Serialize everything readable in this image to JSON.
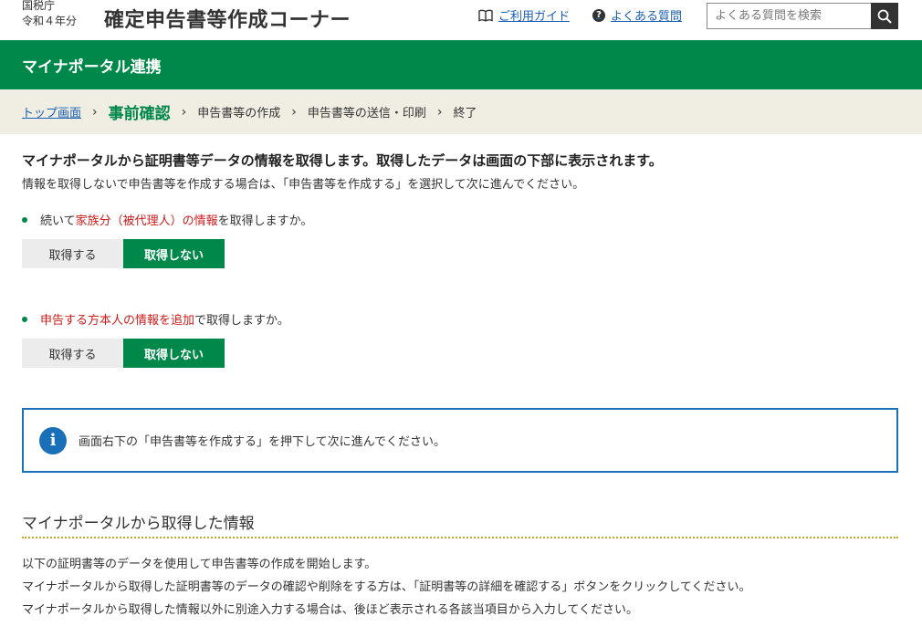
{
  "header": {
    "org_line1": "国税庁",
    "org_line2": "令和４年分",
    "title": "確定申告書等作成コーナー",
    "guide_link": "ご利用ガイド",
    "faq_link": "よくある質問",
    "search_placeholder": "よくある質問を検索"
  },
  "band": {
    "title": "マイナポータル連携"
  },
  "steps": [
    "トップ画面",
    "事前確認",
    "申告書等の作成",
    "申告書等の送信・印刷",
    "終了"
  ],
  "intro": {
    "lead": "マイナポータルから証明書等データの情報を取得します。取得したデータは画面の下部に表示されます。",
    "sub": "情報を取得しないで申告書等を作成する場合は、「申告書等を作成する」を選択して次に進んでください。"
  },
  "q1": {
    "prefix": "続いて",
    "highlight": "家族分（被代理人）の情報",
    "suffix": "を取得しますか。",
    "yes": "取得する",
    "no": "取得しない"
  },
  "q2": {
    "highlight": "申告する方本人の情報を追加",
    "suffix": "で取得しますか。",
    "yes": "取得する",
    "no": "取得しない"
  },
  "info": {
    "icon": "i",
    "text": "画面右下の「申告書等を作成する」を押下して次に進んでください。"
  },
  "section": {
    "title": "マイナポータルから取得した情報",
    "p1": "以下の証明書等のデータを使用して申告書等の作成を開始します。",
    "p2": "マイナポータルから取得した証明書等のデータの確認や削除をする方は、「証明書等の詳細を確認する」ボタンをクリックしてください。",
    "p3": "マイナポータルから取得した情報以外に別途入力する場合は、後ほど表示される各該当項目から入力してください。"
  },
  "colors": {
    "brand_green": "#00874a",
    "link_blue": "#1a5fb4",
    "alert_red": "#d01b1b",
    "info_blue": "#1a6fb9",
    "steps_bg": "#f0eee2"
  },
  "icons": [
    "book-icon",
    "question-icon",
    "search-icon",
    "info-icon",
    "chevron-right-icon"
  ]
}
